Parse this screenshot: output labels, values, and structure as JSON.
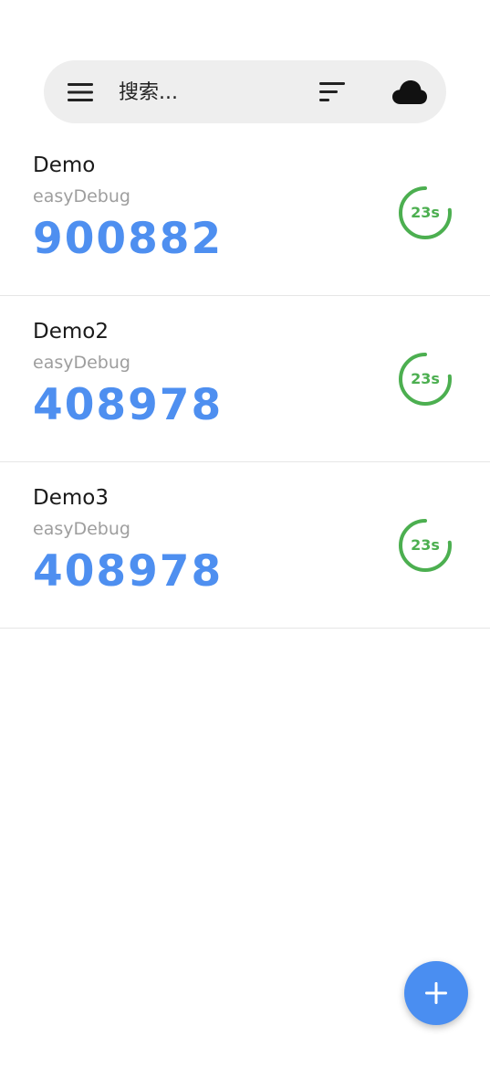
{
  "search": {
    "placeholder": "搜索..."
  },
  "icons": {
    "menu": "menu-icon",
    "sort": "sort-icon",
    "cloud": "cloud-icon",
    "add": "plus-icon"
  },
  "colors": {
    "code": "#4e8ff0",
    "timer": "#4caf50",
    "fab": "#4a8ef1",
    "search_bg": "#eeeeee"
  },
  "accounts": [
    {
      "name": "Demo",
      "issuer": "easyDebug",
      "code": "900882",
      "remaining": "23s",
      "progress": 0.77
    },
    {
      "name": "Demo2",
      "issuer": "easyDebug",
      "code": "408978",
      "remaining": "23s",
      "progress": 0.77
    },
    {
      "name": "Demo3",
      "issuer": "easyDebug",
      "code": "408978",
      "remaining": "23s",
      "progress": 0.77
    }
  ]
}
